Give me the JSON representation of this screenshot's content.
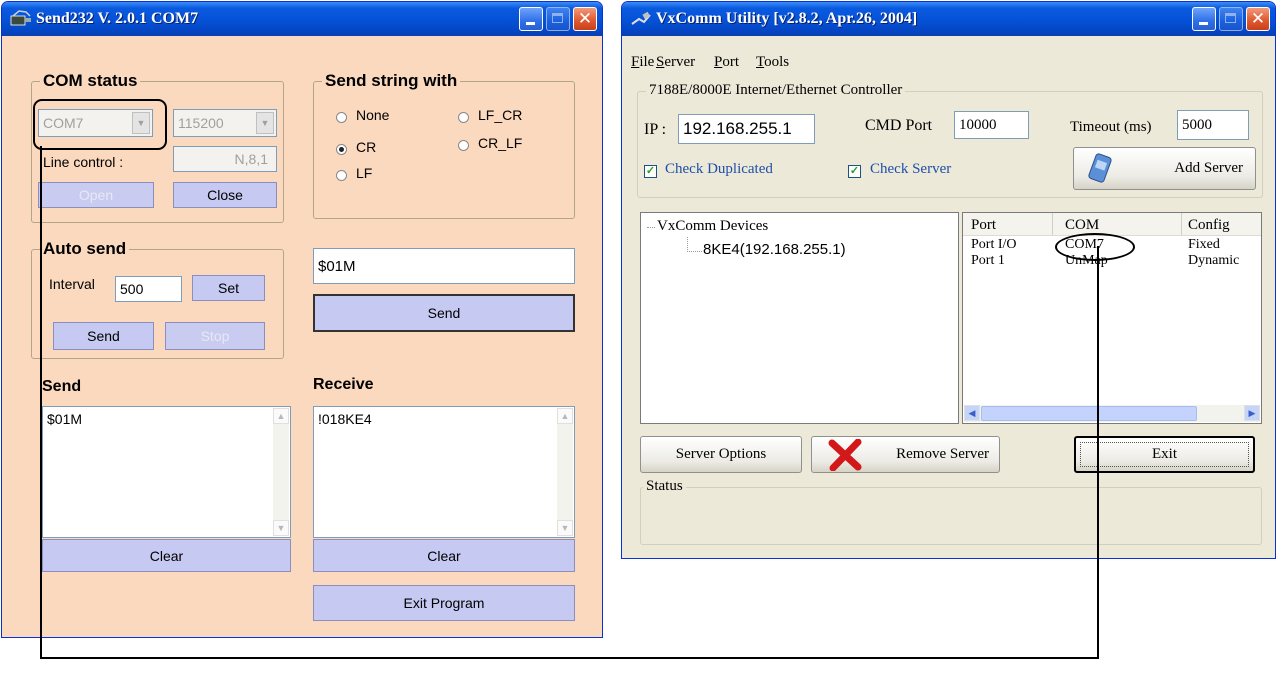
{
  "send232": {
    "title": "Send232  V. 2.0.1  COM7",
    "com_status": {
      "label": "COM status",
      "port": "COM7",
      "baud": "115200",
      "line_control_label": "Line control :",
      "line_control_value": "N,8,1",
      "open_label": "Open",
      "close_label": "Close"
    },
    "send_string_with": {
      "label": "Send string with",
      "options": [
        "None",
        "LF_CR",
        "CR",
        "CR_LF",
        "LF"
      ],
      "selected": "CR"
    },
    "auto_send": {
      "label": "Auto send",
      "interval_label": "Interval",
      "interval_value": "500",
      "set_label": "Set",
      "send_label": "Send",
      "stop_label": "Stop"
    },
    "command_input": "$01M",
    "send_button": "Send",
    "send_section": {
      "label": "Send",
      "text": "$01M",
      "clear_label": "Clear"
    },
    "receive_section": {
      "label": "Receive",
      "text": "!018KE4",
      "clear_label": "Clear"
    },
    "exit_label": "Exit Program"
  },
  "vxcomm": {
    "title": "VxComm Utility [v2.8.2, Apr.26, 2004]",
    "menu": [
      {
        "key": "F",
        "rest": "ile"
      },
      {
        "key": "S",
        "rest": "erver"
      },
      {
        "key": "P",
        "rest": "ort"
      },
      {
        "key": "T",
        "rest": "ools"
      }
    ],
    "controller": {
      "label": "7188E/8000E Internet/Ethernet Controller",
      "ip_label": "IP :",
      "ip_value": "192.168.255.1",
      "cmd_port_label": "CMD Port",
      "cmd_port_value": "10000",
      "timeout_label": "Timeout (ms)",
      "timeout_value": "5000",
      "check_duplicated": "Check Duplicated",
      "check_server": "Check Server",
      "add_server": "Add Server"
    },
    "tree": {
      "root": "VxComm Devices",
      "child": "8KE4(192.168.255.1)"
    },
    "port_table": {
      "headers": [
        "Port",
        "COM",
        "Config"
      ],
      "rows": [
        [
          "Port I/O",
          "COM7",
          "Fixed"
        ],
        [
          "Port 1",
          "UnMap",
          "Dynamic"
        ]
      ]
    },
    "server_options": "Server Options",
    "remove_server": "Remove Server",
    "exit": "Exit",
    "status_label": "Status"
  },
  "colors": {
    "send232_bg": "#fbd9be",
    "button_fill": "#c6c9f1",
    "xp_title_blue": "#0553d8",
    "xp_face": "#ece9d8",
    "annotation": "#000000"
  }
}
